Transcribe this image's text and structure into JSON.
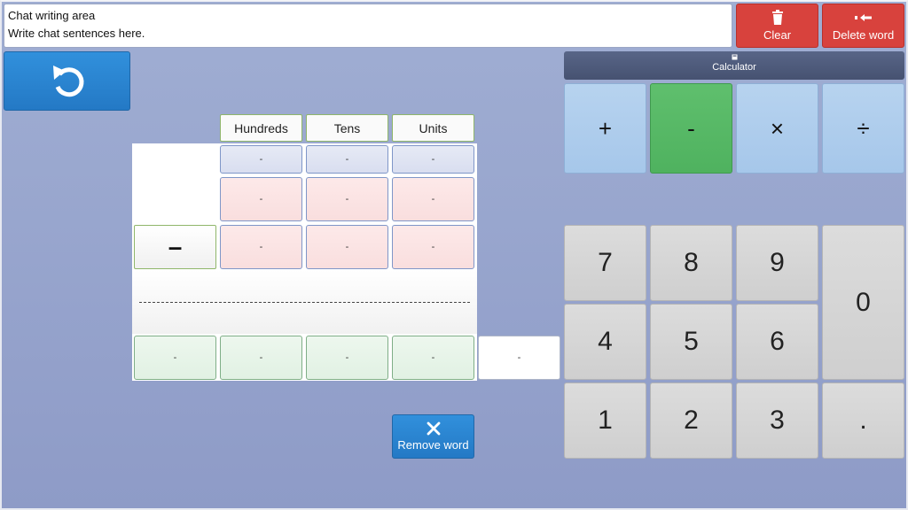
{
  "chat": {
    "title": "Chat writing area",
    "placeholder": "Write chat sentences here."
  },
  "toolbar": {
    "clear_label": "Clear",
    "delete_word_label": "Delete word",
    "remove_word_label": "Remove word"
  },
  "calculator": {
    "title": "Calculator",
    "operators": [
      "+",
      "-",
      "×",
      "÷"
    ],
    "selected_operator": "-",
    "keys": [
      "7",
      "8",
      "9",
      "0",
      "4",
      "5",
      "6",
      "1",
      "2",
      "3",
      "."
    ]
  },
  "worksheet": {
    "columns": [
      "Hundreds",
      "Tens",
      "Units"
    ],
    "carry_row": [
      "-",
      "-",
      "-"
    ],
    "row1": [
      "-",
      "-",
      "-"
    ],
    "row2": [
      "-",
      "-",
      "-"
    ],
    "operation_sign": "–",
    "result_row": [
      "-",
      "-",
      "-",
      "-"
    ],
    "extra_cell": "-"
  },
  "colors": {
    "background": "#97a5cd",
    "red_button": "#d8423d",
    "blue_button": "#2a84d0",
    "active_operator": "#55b765",
    "operator": "#b0cded"
  }
}
